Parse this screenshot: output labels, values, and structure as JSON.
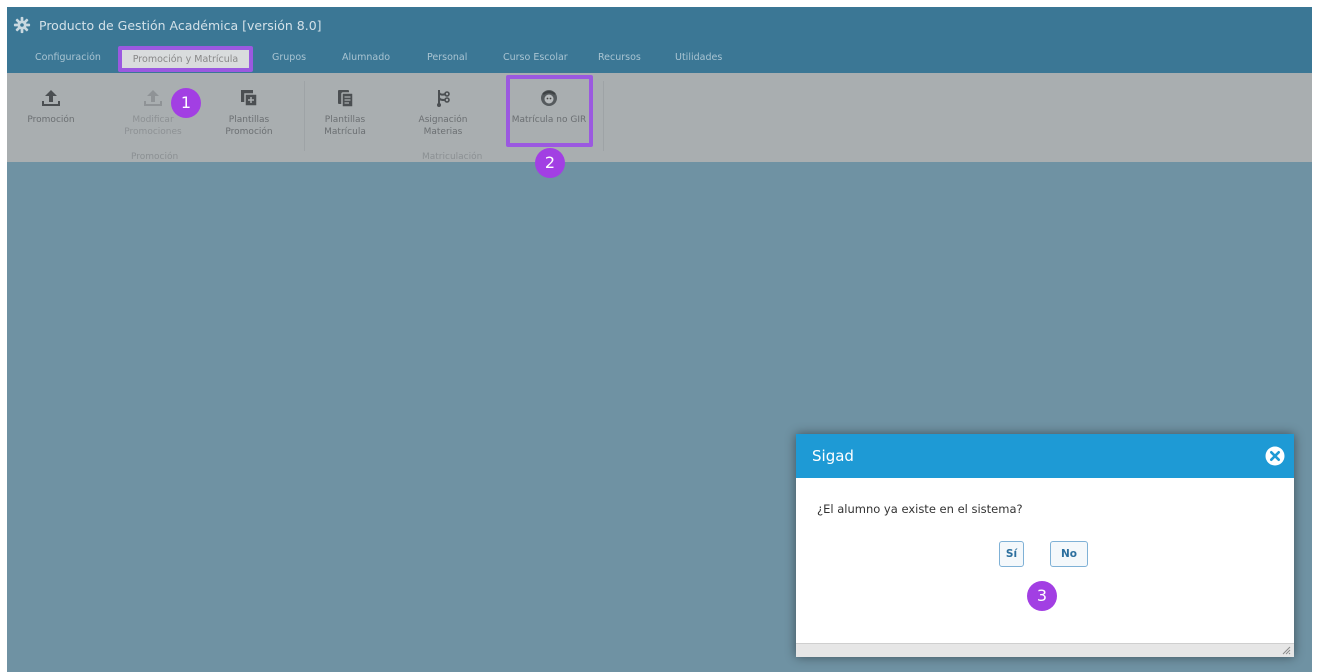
{
  "window": {
    "title": "Producto de Gestión Académica [versión 8.0]"
  },
  "menu": {
    "items": [
      "Configuración",
      "Promoción y Matrícula",
      "Grupos",
      "Alumnado",
      "Personal",
      "Curso Escolar",
      "Recursos",
      "Utilidades"
    ],
    "active": "Promoción y Matrícula"
  },
  "ribbon": {
    "promocion": {
      "label": "Promoción",
      "icon": "upload-icon"
    },
    "modificar": {
      "label1": "Modificar",
      "label2": "Promociones",
      "icon": "upload-icon",
      "enabled": false
    },
    "plantillas_promo": {
      "label1": "Plantillas",
      "label2": "Promoción",
      "icon": "template-stack-icon"
    },
    "group_promocion": "Promoción",
    "plantillas_matricula": {
      "label1": "Plantillas",
      "label2": "Matrícula",
      "icon": "document-copy-icon"
    },
    "asignacion": {
      "label1": "Asignación",
      "label2": "Materias",
      "icon": "tree-branch-icon"
    },
    "matricula_no_gir": {
      "label": "Matrícula no GIR",
      "icon": "student-face-icon"
    },
    "group_matriculacion": "Matriculación"
  },
  "badges": [
    "1",
    "2",
    "3"
  ],
  "dialog": {
    "title": "Sigad",
    "message": "¿El alumno ya existe en el sistema?",
    "yes_label": "Sí",
    "no_label": "No"
  },
  "colors": {
    "titlebar": "#3b7795",
    "workspace": "#6f92a3",
    "ribbon": "#a9aeb0",
    "highlight": "#9b59e0",
    "badge": "#a23fe3",
    "dialog_header": "#1e9ad5"
  }
}
